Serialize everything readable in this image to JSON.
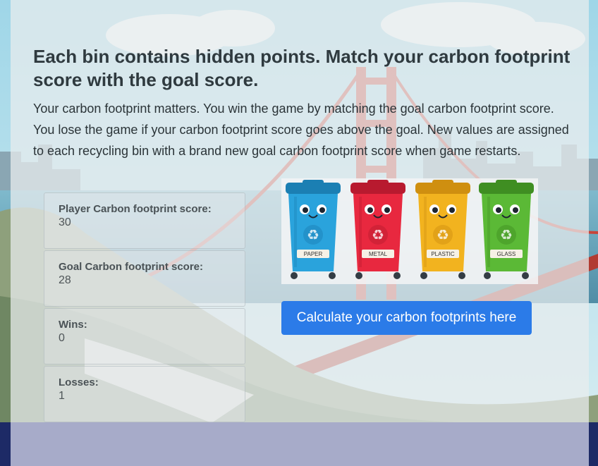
{
  "heading": "Each bin contains hidden points. Match your carbon footprint score with the goal score.",
  "intro": "Your carbon footprint matters. You win the game by matching the goal carbon footprint score. You lose the game if your carbon footprint score goes above the goal. New values are assigned to each recycling bin with a brand new goal carbon footprint score when game restarts.",
  "stats": [
    {
      "label": "Player Carbon footprint score:",
      "value": "30"
    },
    {
      "label": "Goal Carbon footprint score:",
      "value": "28"
    },
    {
      "label": "Wins:",
      "value": "0"
    },
    {
      "label": "Losses:",
      "value": "1"
    }
  ],
  "bins": [
    {
      "label": "PAPER",
      "color": "#2aa3dc",
      "dark": "#1b7fb3",
      "icon": "recycle-icon"
    },
    {
      "label": "METAL",
      "color": "#e8283f",
      "dark": "#b81a2f",
      "icon": "recycle-icon"
    },
    {
      "label": "PLASTIC",
      "color": "#f2b31f",
      "dark": "#cf8f10",
      "icon": "recycle-icon"
    },
    {
      "label": "GLASS",
      "color": "#5bb936",
      "dark": "#3f8e22",
      "icon": "recycle-icon"
    }
  ],
  "calc_button": "Calculate your carbon footprints here",
  "colors": {
    "button": "#2b7be8",
    "footer": "#1d2a66"
  }
}
